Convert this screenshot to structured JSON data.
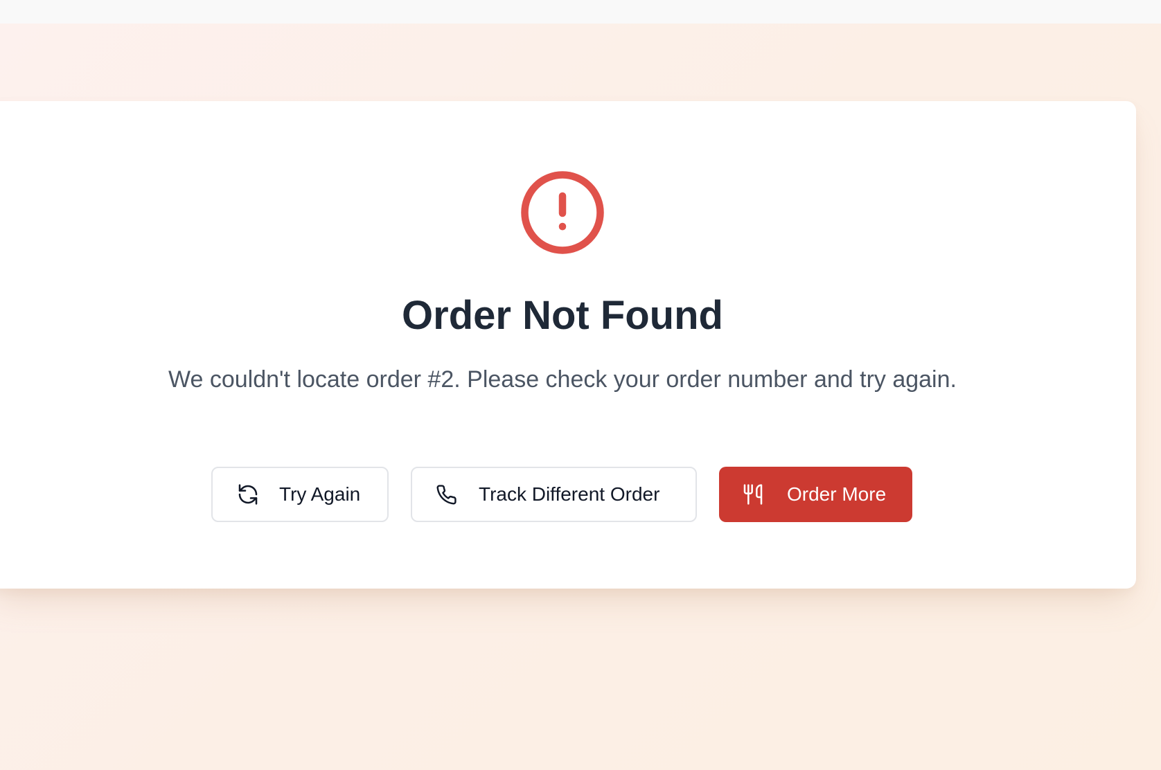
{
  "colors": {
    "accent": "#cc3a31",
    "icon_red": "#e0524b",
    "title": "#1f2937",
    "message": "#4b5563"
  },
  "error": {
    "icon": "alert-circle-icon",
    "title": "Order Not Found",
    "message": "We couldn't locate order #2. Please check your order number and try again."
  },
  "actions": {
    "try_again": {
      "label": "Try Again",
      "icon": "refresh-icon"
    },
    "track_different": {
      "label": "Track Different Order",
      "icon": "phone-icon"
    },
    "order_more": {
      "label": "Order More",
      "icon": "utensils-icon"
    }
  }
}
